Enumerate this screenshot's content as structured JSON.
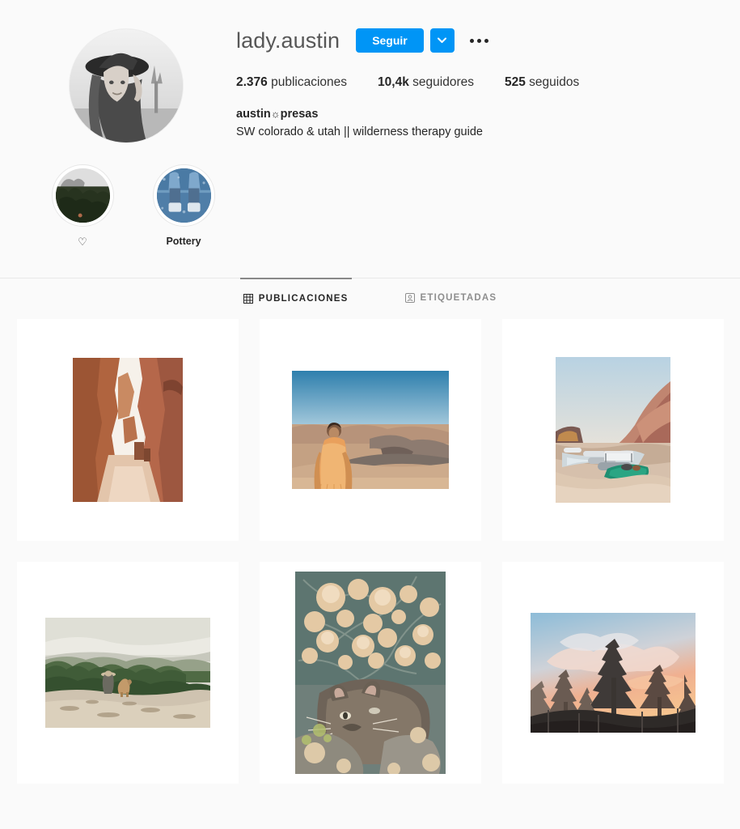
{
  "profile": {
    "username": "lady.austin",
    "avatar_alt": "avatar-photo",
    "follow_label": "Seguir",
    "caret_icon": "chevron-down-icon",
    "options_icon": "more-options-icon",
    "stats": [
      {
        "value": "2.376",
        "label": "publicaciones",
        "name": "posts-count"
      },
      {
        "value": "10,4k",
        "label": "seguidores",
        "name": "followers-count"
      },
      {
        "value": "525",
        "label": "seguidos",
        "name": "following-count"
      }
    ],
    "bio_name_prefix": "austin",
    "bio_name_glyph": "☼",
    "bio_name_suffix": "presas",
    "bio_text": "SW colorado & utah || wilderness therapy guide"
  },
  "highlights": [
    {
      "label": "♡",
      "name": "story-highlight-heart",
      "is_heart": true
    },
    {
      "label": "Pottery",
      "name": "story-highlight-pottery",
      "is_heart": false
    }
  ],
  "tabs": [
    {
      "label": "PUBLICACIONES",
      "icon": "grid-icon",
      "active": true,
      "name": "tab-publicaciones"
    },
    {
      "label": "ETIQUETADAS",
      "icon": "tagged-person-icon",
      "active": false,
      "name": "tab-etiquetadas"
    }
  ],
  "posts": [
    {
      "name": "post-slot-canyon",
      "alt": "red rock slot canyon",
      "multi": false
    },
    {
      "name": "post-desert-portrait",
      "alt": "person in orange shawl in desert badlands",
      "multi": true
    },
    {
      "name": "post-river-rafts",
      "alt": "rafts on river beach under red canyon walls",
      "multi": true
    },
    {
      "name": "post-forest-overlook",
      "alt": "person and dog on rock overlook above pine forest",
      "multi": false
    },
    {
      "name": "post-cat-in-rabbitbrush",
      "alt": "tabby cat resting under rabbitbrush blooms",
      "multi": false
    },
    {
      "name": "post-sunset-pines",
      "alt": "pine trees silhouetted against pink sunset sky",
      "multi": false
    }
  ],
  "colors": {
    "instagram_blue": "#0095f6",
    "page_background": "#fafafa",
    "tile_background": "#ffffff",
    "primary_text": "#262626",
    "muted_text": "#8e8e8e"
  }
}
